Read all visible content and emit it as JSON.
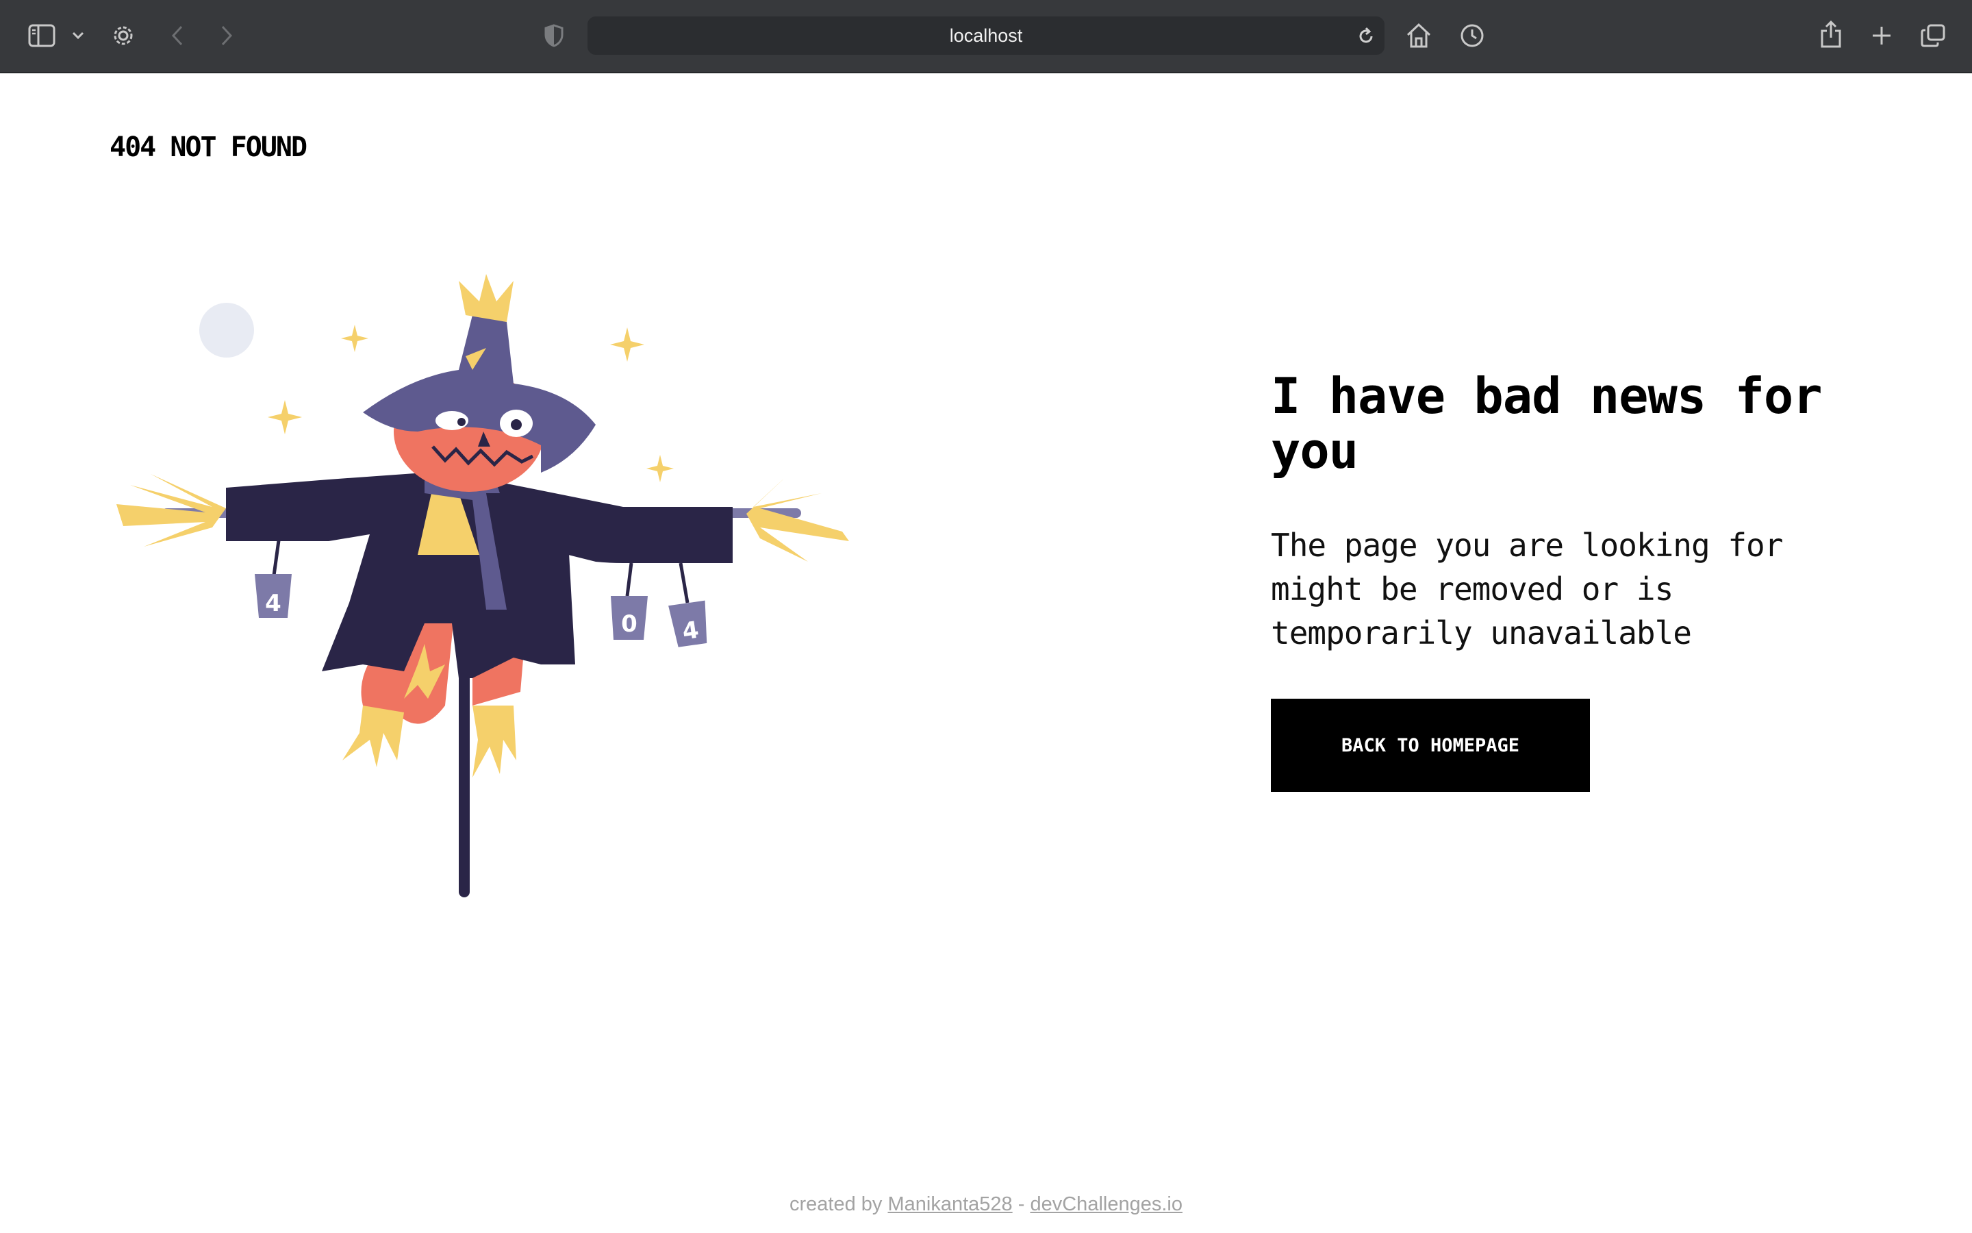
{
  "browser": {
    "address": "localhost",
    "icons": [
      "sidebar-icon",
      "chevron-down-icon",
      "gear-icon",
      "back-arrow-icon",
      "forward-arrow-icon",
      "shield-icon",
      "reload-icon",
      "home-icon",
      "history-icon",
      "share-icon",
      "plus-icon",
      "tabs-overview-icon"
    ]
  },
  "page": {
    "site_title": "404 NOT FOUND",
    "heading": "I have bad news for you",
    "subtext": "The page you are looking for might be removed or is temporarily unavailable",
    "button_label": "BACK TO HOMEPAGE",
    "illustration_alt": "scarecrow-illustration",
    "cans": [
      "4",
      "0",
      "4"
    ]
  },
  "footer": {
    "prefix": "created by",
    "author": "Manikanta528",
    "separator": "-",
    "site": "devChallenges.io"
  },
  "colors": {
    "chrome": "#37393c",
    "address_bg": "#2b2d30",
    "button_bg": "#000000",
    "hat": "#5e5a8f",
    "coat": "#2a2547",
    "skin": "#ef7461",
    "straw": "#f5d06b",
    "can": "#7d7aa8"
  }
}
